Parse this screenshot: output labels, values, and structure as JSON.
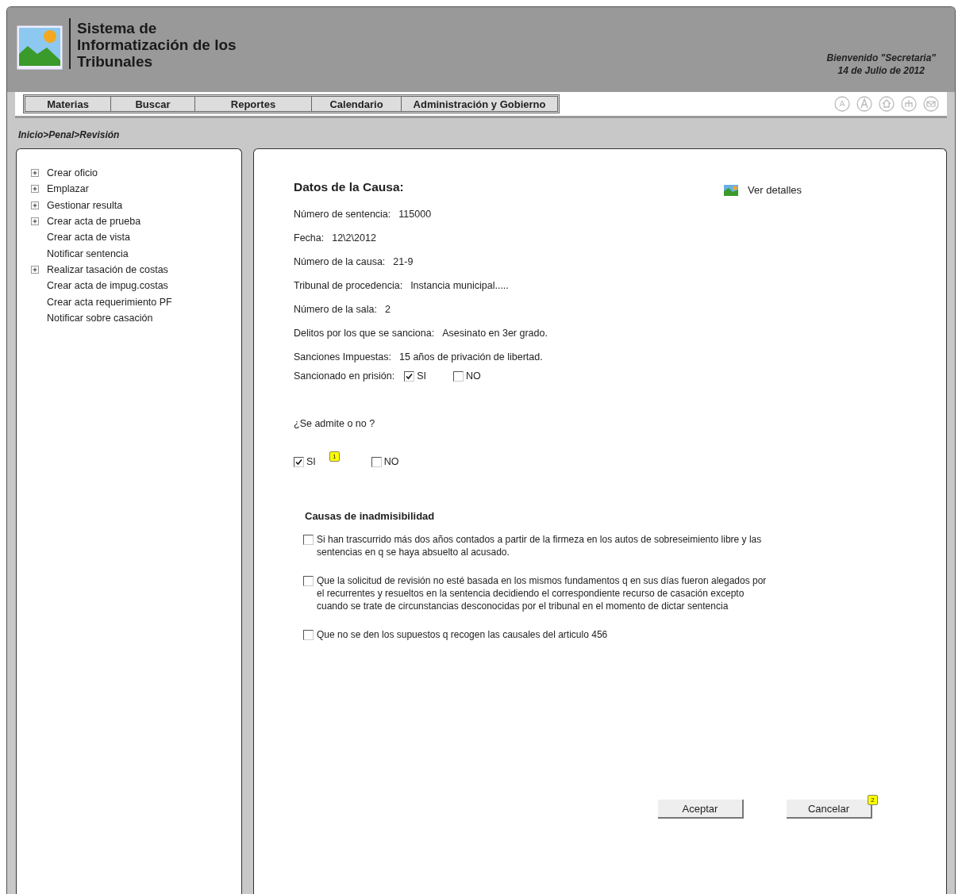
{
  "header": {
    "title_lines": [
      "Sistema de",
      "Informatización de los",
      "Tribunales"
    ],
    "welcome": "Bienvenido \"Secretaria\"",
    "date": "14 de Julio de 2012"
  },
  "menu": [
    {
      "label": "Materias"
    },
    {
      "label": "Buscar"
    },
    {
      "label": "Reportes"
    },
    {
      "label": "Calendario"
    },
    {
      "label": "Administración y Gobierno"
    }
  ],
  "breadcrumb": "Inicio>Penal>Revisión",
  "sidebar": {
    "items": [
      {
        "label": "Crear oficio",
        "expandable": true
      },
      {
        "label": "Emplazar",
        "expandable": true
      },
      {
        "label": "Gestionar resulta",
        "expandable": true
      },
      {
        "label": "Crear acta de prueba",
        "expandable": true
      },
      {
        "label": "Crear acta de vista",
        "expandable": false
      },
      {
        "label": "Notificar sentencia",
        "expandable": false
      },
      {
        "label": "Realizar tasación de costas",
        "expandable": true
      },
      {
        "label": "Crear acta de impug.costas",
        "expandable": false
      },
      {
        "label": "Crear acta requerimiento PF",
        "expandable": false
      },
      {
        "label": "Notificar sobre casación",
        "expandable": false
      }
    ]
  },
  "case": {
    "title": "Datos de la Causa:",
    "details_link": "Ver detalles",
    "fields": [
      {
        "label": "Número de sentencia:",
        "value": "115000"
      },
      {
        "label": "Fecha:",
        "value": "12\\2\\2012"
      },
      {
        "label": "Número de la causa:",
        "value": "21-9"
      },
      {
        "label": "Tribunal de procedencia:",
        "value": "Instancia municipal....."
      },
      {
        "label": "Número de la sala:",
        "value": "2"
      },
      {
        "label": "Delitos por los que se sanciona:",
        "value": "Asesinato en 3er grado."
      },
      {
        "label": "Sanciones Impuestas:",
        "value": "15 años de privación de libertad."
      }
    ],
    "imprisoned": {
      "label": "Sancionado en prisión:",
      "options": [
        {
          "label": "SI",
          "checked": true
        },
        {
          "label": "NO",
          "checked": false
        }
      ]
    }
  },
  "admission": {
    "question": "¿Se admite o no ?",
    "options": [
      {
        "label": "SI",
        "checked": true,
        "note": "1"
      },
      {
        "label": "NO",
        "checked": false
      }
    ]
  },
  "inadmissibility": {
    "title": "Causas de inadmisibilidad",
    "items": [
      {
        "text": "Si han  trascurrido más dos años contados a partir de la firmeza en los autos de sobreseimiento libre y las sentencias en q se haya absuelto al acusado.",
        "checked": false
      },
      {
        "text": "Que la solicitud de revisión no esté basada en los mismos fundamentos q en sus días fueron alegados por el recurrentes y resueltos en la sentencia decidiendo el correspondiente recurso de casación excepto cuando se trate de circunstancias desconocidas por el tribunal en el momento de dictar sentencia",
        "checked": false
      },
      {
        "text": "Que no se den los supuestos q recogen las causales del articulo 456",
        "checked": false
      }
    ]
  },
  "buttons": [
    {
      "label": "Aceptar"
    },
    {
      "label": "Cancelar",
      "note": "2"
    }
  ]
}
